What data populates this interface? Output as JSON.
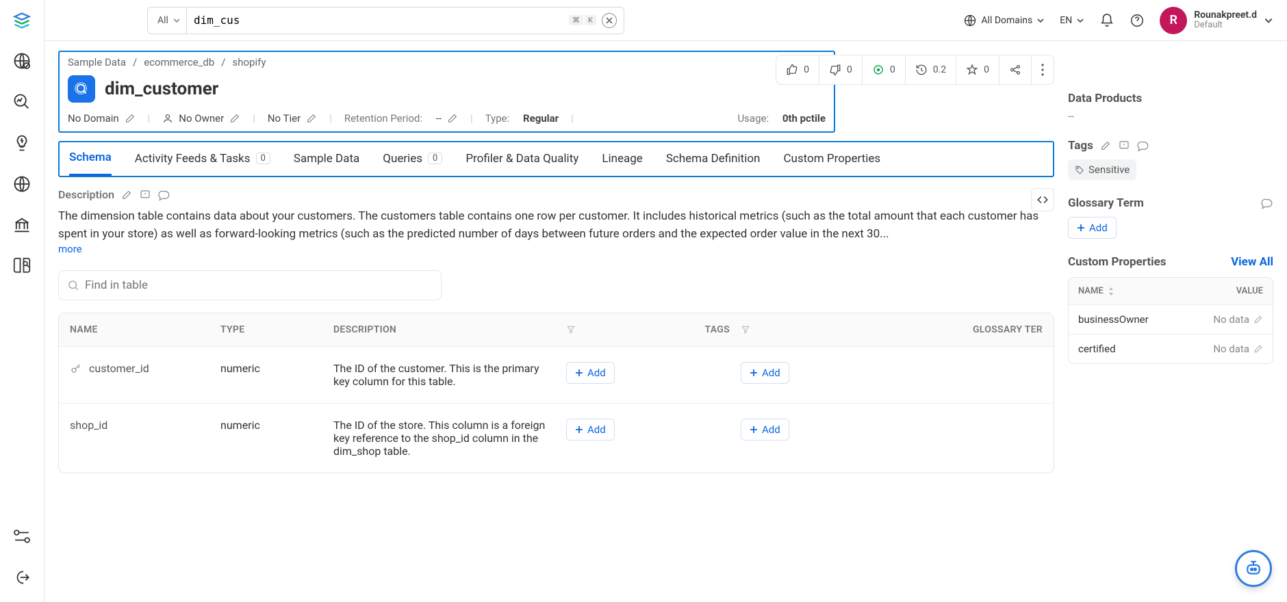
{
  "search": {
    "scope": "All",
    "value": "dim_cus",
    "kbd1": "⌘",
    "kbd2": "K"
  },
  "topbar": {
    "domains": "All Domains",
    "lang": "EN",
    "user_initial": "R",
    "user_name": "Rounakpreet.d",
    "user_sub": "Default"
  },
  "breadcrumb": [
    "Sample Data",
    "ecommerce_db",
    "shopify"
  ],
  "entity": {
    "title": "dim_customer"
  },
  "meta": {
    "domain": "No Domain",
    "owner": "No Owner",
    "tier": "No Tier",
    "retention_label": "Retention Period:",
    "retention_value": "--",
    "type_label": "Type:",
    "type_value": "Regular",
    "usage_label": "Usage:",
    "usage_value": "0th pctile"
  },
  "stats": {
    "up": "0",
    "down": "0",
    "runs": "0",
    "time": "0.2",
    "star": "0"
  },
  "tabs": {
    "schema": "Schema",
    "activity": "Activity Feeds & Tasks",
    "activity_count": "0",
    "sample": "Sample Data",
    "queries": "Queries",
    "queries_count": "0",
    "profiler": "Profiler & Data Quality",
    "lineage": "Lineage",
    "schemadef": "Schema Definition",
    "custom": "Custom Properties"
  },
  "description": {
    "label": "Description",
    "text": "The dimension table contains data about your customers. The customers table contains one row per customer. It includes historical metrics (such as the total amount that each customer has spent in your store) as well as forward-looking metrics (such as the predicted number of days between future orders and the expected order value in the next 30...",
    "more": "more"
  },
  "find_placeholder": "Find in table",
  "columns": {
    "headers": {
      "name": "NAME",
      "type": "TYPE",
      "desc": "DESCRIPTION",
      "tags": "TAGS",
      "glossary": "GLOSSARY TER"
    },
    "rows": [
      {
        "name": "customer_id",
        "type": "numeric",
        "desc": "The ID of the customer. This is the primary key column for this table."
      },
      {
        "name": "shop_id",
        "type": "numeric",
        "desc": "The ID of the store. This column is a foreign key reference to the shop_id column in the dim_shop table."
      }
    ],
    "add": "Add"
  },
  "rightpane": {
    "data_products": {
      "title": "Data Products",
      "value": "--"
    },
    "tags": {
      "title": "Tags",
      "chip": "Sensitive"
    },
    "glossary": {
      "title": "Glossary Term",
      "add": "Add"
    },
    "custom": {
      "title": "Custom Properties",
      "viewall": "View All",
      "headers": {
        "name": "NAME",
        "value": "VALUE"
      },
      "rows": [
        {
          "name": "businessOwner",
          "value": "No data"
        },
        {
          "name": "certified",
          "value": "No data"
        }
      ]
    }
  }
}
